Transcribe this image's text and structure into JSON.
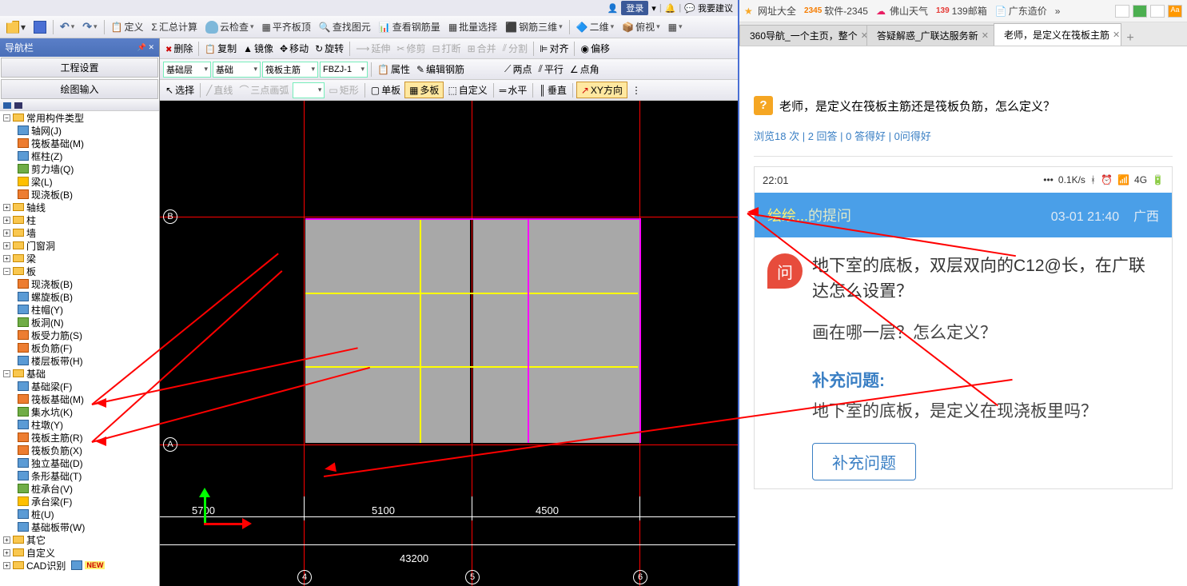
{
  "top_toolbar": {
    "login": "登录",
    "suggest": "我要建议"
  },
  "menu_bar": {
    "define": "定义",
    "sum_calc": "汇总计算",
    "cloud_check": "云检查",
    "level_slab": "平齐板顶",
    "find_elem": "查找图元",
    "view_rebar": "查看钢筋量",
    "batch_select": "批量选择",
    "rebar_3d": "钢筋三维",
    "two_d": "二维",
    "bird_view": "俯视"
  },
  "nav": {
    "title": "导航栏",
    "btn1": "工程设置",
    "btn2": "绘图输入",
    "categories": {
      "common": "常用构件类型",
      "axis": "轴线",
      "column": "柱",
      "wall": "墙",
      "door_window": "门窗洞",
      "beam": "梁",
      "slab": "板",
      "foundation": "基础",
      "other": "其它",
      "custom": "自定义",
      "cad": "CAD识别"
    },
    "common_items": [
      "轴网(J)",
      "筏板基础(M)",
      "框柱(Z)",
      "剪力墙(Q)",
      "梁(L)",
      "现浇板(B)"
    ],
    "slab_items": [
      "现浇板(B)",
      "螺旋板(B)",
      "柱帽(Y)",
      "板洞(N)",
      "板受力筋(S)",
      "板负筋(F)",
      "楼层板带(H)"
    ],
    "foundation_items": [
      "基础梁(F)",
      "筏板基础(M)",
      "集水坑(K)",
      "柱墩(Y)",
      "筏板主筋(R)",
      "筏板负筋(X)",
      "独立基础(D)",
      "条形基础(T)",
      "桩承台(V)",
      "承台梁(F)",
      "桩(U)",
      "基础板带(W)"
    ],
    "new_label": "NEW"
  },
  "toolbar2": {
    "delete": "删除",
    "copy": "复制",
    "mirror": "镜像",
    "move": "移动",
    "rotate": "旋转",
    "extend": "延伸",
    "trim": "修剪",
    "break": "打断",
    "merge": "合并",
    "split": "分割",
    "align": "对齐",
    "offset": "偏移"
  },
  "toolbar3": {
    "floor": "基础层",
    "category": "基础",
    "member": "筏板主筋",
    "name": "FBZJ-1",
    "property": "属性",
    "edit_rebar": "编辑钢筋"
  },
  "toolbar3b": {
    "two_point": "两点",
    "parallel": "平行",
    "point_angle": "点角"
  },
  "toolbar4": {
    "select": "选择",
    "line": "直线",
    "arc": "三点画弧",
    "rect": "矩形",
    "single": "单板",
    "multi": "多板",
    "custom": "自定义",
    "horizontal": "水平",
    "vertical": "垂直",
    "xy": "XY方向"
  },
  "canvas": {
    "axis_b": "B",
    "axis_a": "A",
    "axis_4": "4",
    "axis_5": "5",
    "axis_6": "6",
    "dim1": "5700",
    "dim2": "5100",
    "dim3": "4500",
    "dim_total": "43200"
  },
  "bookmark": {
    "sites": "网址大全",
    "software": "软件-2345",
    "weather": "佛山天气",
    "mail": "139邮箱",
    "gd_price": "广东造价"
  },
  "tabs": [
    {
      "label": "360导航_一个主页，整个"
    },
    {
      "label": "答疑解惑_广联达服务新"
    },
    {
      "label": "老师，是定义在筏板主筋",
      "active": true
    }
  ],
  "question": {
    "title": "老师，是定义在筏板主筋还是筏板负筋，怎么定义？",
    "stats_views": "浏览18 次",
    "stats_ans": "2 回答",
    "stats_good": "0 答得好",
    "stats_qgood": "0问得好",
    "mobile_time": "22:01",
    "mobile_speed": "0.1K/s",
    "mobile_net": "4G",
    "asker": "绘绘...",
    "asker_suffix": "的提问",
    "post_time": "03-01 21:40",
    "location": "广西",
    "q_badge": "问",
    "main_q": "地下室的底板，双层双向的C12@长，在广联达怎么设置？",
    "sub_q": "画在哪一层？怎么定义？",
    "supplement_title": "补充问题:",
    "supplement_text": "地下室的底板，是定义在现浇板里吗？",
    "supplement_btn": "补充问题"
  }
}
